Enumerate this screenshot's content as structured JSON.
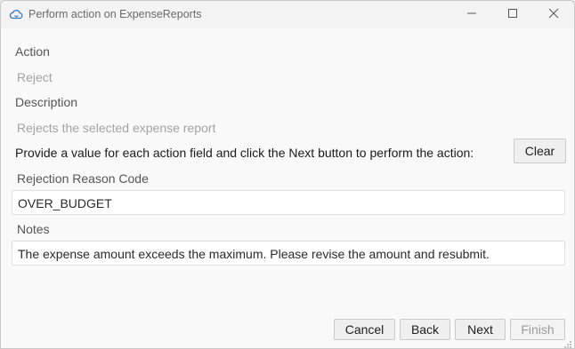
{
  "window": {
    "title": "Perform action on ExpenseReports",
    "icons": {
      "app": "cloud-icon",
      "minimize": "minimize-icon",
      "maximize": "maximize-icon",
      "close": "close-icon"
    }
  },
  "form": {
    "action_label": "Action",
    "action_value": "Reject",
    "description_label": "Description",
    "description_value": "Rejects the selected expense report",
    "instruction": "Provide a value for each action field and click the Next button to perform the action:",
    "clear_label": "Clear",
    "fields": [
      {
        "label": "Rejection Reason Code",
        "value": "OVER_BUDGET"
      },
      {
        "label": "Notes",
        "value": "The expense amount exceeds the maximum. Please revise the amount and resubmit."
      }
    ]
  },
  "buttons": {
    "cancel": "Cancel",
    "back": "Back",
    "next": "Next",
    "finish": "Finish"
  }
}
